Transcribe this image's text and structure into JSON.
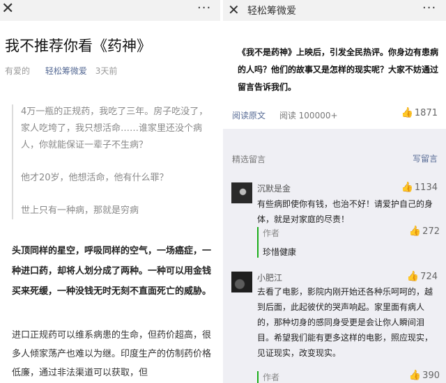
{
  "left": {
    "close_icon": "✕",
    "more_icon": "···",
    "title": "我不推荐你看《药神》",
    "meta": {
      "tag": "有爱的",
      "author": "轻松筹微爱",
      "time": "3天前"
    },
    "quote": [
      "4万一瓶的正规药，我吃了三年。房子吃没了，家人吃垮了，我只想活命……谁家里还没个病人，你就能保证一辈子不生病？",
      "他才20岁，他想活命，他有什么罪？",
      "世上只有一种病，那就是穷病"
    ],
    "bold_paragraph": "头顶同样的星空，呼吸同样的空气，一场癌症，一种进口药，却将人划分成了两种。一种可以用金钱买来死缓，一种没钱无时无刻不直面死亡的威胁。",
    "paragraph": "进口正规药可以维系病患的生命，但药价超高，很多人倾家荡产也难以为继。印度生产的仿制药价格低廉，通过非法渠道可以获取，但"
  },
  "right": {
    "back_icon": "✕",
    "more_icon": "···",
    "account_name": "轻松筹微爱",
    "intro": "《我不是药神》上映后，引发全民热评。你身边有患病的人吗？他们的故事又是怎样的现实呢？大家不妨通过留言告诉我们。",
    "read_original": "阅读原文",
    "reads": "阅读 100000+",
    "likes": "1871",
    "selected_label": "精选留言",
    "write_comment": "写留言",
    "comments": [
      {
        "name": "沉默是金",
        "likes": "1134",
        "text": "有些病即使你有钱，也治不好！请爱护自己的身体，就是对家庭的尽责！",
        "reply_author": "作者",
        "reply_text": "珍惜健康",
        "reply_likes": "272"
      },
      {
        "name": "小肥江",
        "likes": "724",
        "text": "去看了电影，影院内刚开始还各种乐呵呵的，越到后面，此起彼伏的哭声响起。家里面有病人的，那种切身的感同身受更是会让你人瞬间泪目。希望我们能有更多这样的电影，照应现实，见证现实，改变现实。",
        "reply_author": "作者",
        "reply_likes": "390"
      }
    ]
  },
  "colors": {
    "link": "#576b95",
    "author_bar": "#1aad19",
    "comment_bg": "#efeff4"
  },
  "icons": {
    "close": "close-icon",
    "more": "more-icon",
    "thumb": "thumbs-up-icon"
  }
}
